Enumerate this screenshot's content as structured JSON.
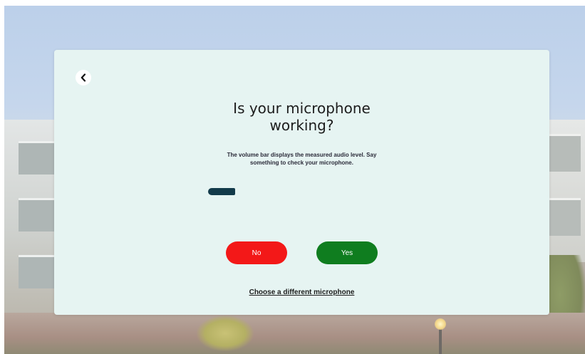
{
  "modal": {
    "title_line1": "Is your microphone",
    "title_line2": "working?",
    "description_line1": "The volume bar displays the measured audio level. Say",
    "description_line2": "something to check your microphone.",
    "back_icon": "chevron-left-icon",
    "volume_level_percent": 19,
    "no_label": "No",
    "yes_label": "Yes",
    "alt_link_label": "Choose a different microphone"
  },
  "colors": {
    "modal_bg": "#e6f4f2",
    "no_button": "#f31818",
    "yes_button": "#0f7d1f",
    "volume_bar": "#123a4a"
  }
}
